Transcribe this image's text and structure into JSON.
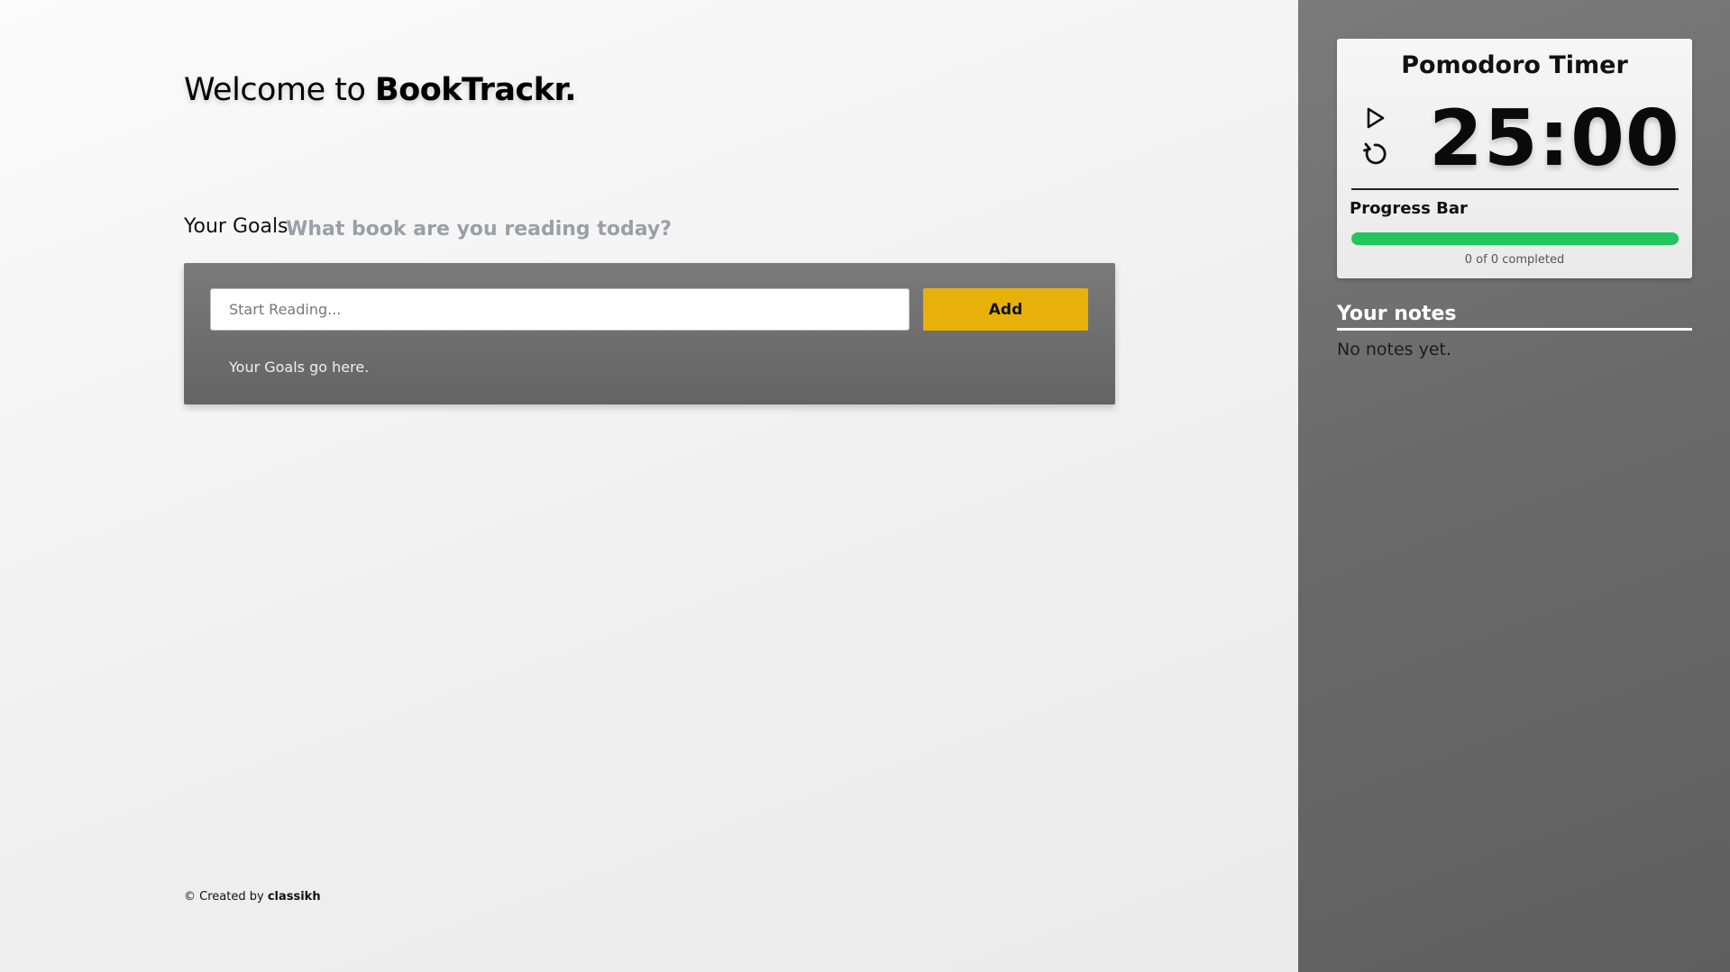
{
  "header": {
    "welcome_prefix": "Welcome to",
    "brand": "BookTrackr."
  },
  "goals": {
    "heading": "Your Goals",
    "question": "What book are you reading today?",
    "input_placeholder": "Start Reading...",
    "input_value": "",
    "add_label": "Add",
    "empty_text": "Your Goals go here."
  },
  "footer": {
    "prefix": "© Created by",
    "author": "classikh"
  },
  "timer": {
    "title": "Pomodoro Timer",
    "display": "25:00",
    "play_icon": "play-icon",
    "reset_icon": "reset-icon",
    "progress_label": "Progress Bar",
    "progress_fraction": 1.0,
    "progress_text": "0 of 0 completed"
  },
  "notes": {
    "heading": "Your notes",
    "empty_text": "No notes yet."
  },
  "colors": {
    "accent_button": "#e8b10a",
    "progress_fill": "#22c55e",
    "question_text": "#9aa0a8",
    "panel_dark": "#6e6e6e"
  }
}
